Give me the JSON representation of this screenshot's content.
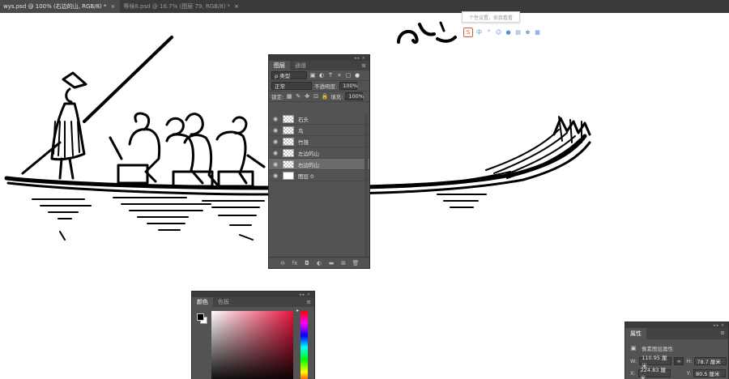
{
  "tabs": [
    {
      "label": "wys.psd @ 100% (右边的山, RGB/8) *",
      "close": "×"
    },
    {
      "label": "等候8.psd @ 16.7% (图层 79, RGB/8) *",
      "close": "×"
    }
  ],
  "ime": {
    "tooltip": "个性设置，依我看看",
    "toolbar_icons": [
      "s-logo-icon",
      "chinese-mode-icon",
      "punctuation-icon",
      "emoji-icon",
      "voice-icon",
      "keyboard-icon",
      "skin-icon",
      "toolbox-icon"
    ]
  },
  "layers_panel": {
    "tabs": [
      "图层",
      "通道"
    ],
    "filter_select": "ρ 类型",
    "blend_mode": "正常",
    "opacity_label": "不透明度:",
    "opacity_value": "100%",
    "lock_label": "锁定:",
    "fill_label": "填充:",
    "fill_value": "100%",
    "layers": [
      {
        "name": "石头",
        "visible": true,
        "thumb": "transparent",
        "selected": false
      },
      {
        "name": "鸟",
        "visible": true,
        "thumb": "transparent",
        "selected": false
      },
      {
        "name": "竹筏",
        "visible": true,
        "thumb": "transparent",
        "selected": false
      },
      {
        "name": "左边的山",
        "visible": true,
        "thumb": "transparent",
        "selected": false
      },
      {
        "name": "右边的山",
        "visible": true,
        "thumb": "transparent",
        "selected": true
      },
      {
        "name": "图层 0",
        "visible": true,
        "thumb": "white",
        "selected": false
      }
    ],
    "footer_icons": [
      "link-layers-icon",
      "fx-icon",
      "mask-icon",
      "adjustment-icon",
      "group-folder-icon",
      "new-layer-icon",
      "trash-icon"
    ],
    "footer_glyphs": [
      "⊖",
      "fx",
      "◘",
      "◐",
      "▬",
      "⊞",
      "🗑"
    ]
  },
  "color_panel": {
    "tabs": [
      "颜色",
      "色板"
    ],
    "foreground": "#000000",
    "background": "#ffffff"
  },
  "properties_panel": {
    "tab": "属性",
    "subtitle": "像素图层属性",
    "w_label": "W:",
    "w_value": "110.95 厘米",
    "h_label": "H:",
    "h_value": "78.7 厘米",
    "x_label": "X:",
    "x_value": "224.83 厘米",
    "y_label": "Y:",
    "y_value": "80.5 厘米"
  }
}
